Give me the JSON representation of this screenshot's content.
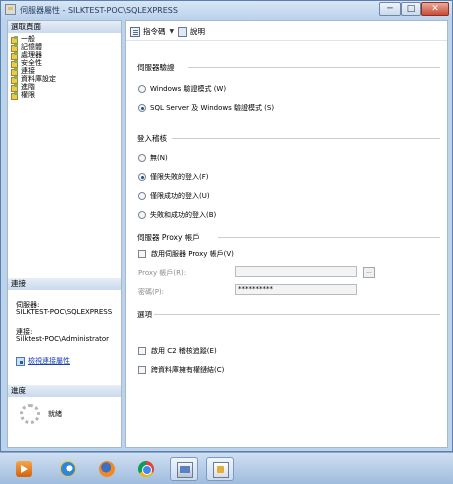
{
  "window": {
    "title": "伺服器屬性 - SILKTEST-POC\\SQLEXPRESS",
    "buttons": {
      "minimize": "─",
      "maximize": "□",
      "close": "✕"
    }
  },
  "left_pane": {
    "select_page_header": "選取頁面",
    "pages": [
      {
        "label": "一般",
        "icon": "page-icon"
      },
      {
        "label": "記憶體",
        "icon": "page-icon"
      },
      {
        "label": "處理器",
        "icon": "page-icon"
      },
      {
        "label": "安全性",
        "icon": "page-icon"
      },
      {
        "label": "連接",
        "icon": "page-icon"
      },
      {
        "label": "資料庫設定",
        "icon": "page-icon"
      },
      {
        "label": "進階",
        "icon": "page-icon"
      },
      {
        "label": "權限",
        "icon": "page-icon"
      }
    ],
    "connection_header": "連接",
    "server_label": "伺服器:",
    "server_value": "SILKTEST-POC\\SQLEXPRESS",
    "connection_label": "連接:",
    "connection_value": "Silktest-POC\\Administrator",
    "view_connection_link": "檢視連接屬性",
    "progress_header": "進度",
    "progress_status": "就緒"
  },
  "toolbar": {
    "script_label": "指令碼",
    "help_label": "說明"
  },
  "server_auth": {
    "title": "伺服器驗證",
    "options": [
      {
        "label": "Windows 驗證模式 (W)",
        "selected": false
      },
      {
        "label": "SQL Server 及 Windows 驗證模式 (S)",
        "selected": true
      }
    ]
  },
  "login_audit": {
    "title": "登入稽核",
    "options": [
      {
        "label": "無(N)",
        "selected": false
      },
      {
        "label": "僅限失敗的登入(F)",
        "selected": true
      },
      {
        "label": "僅限成功的登入(U)",
        "selected": false
      },
      {
        "label": "失敗和成功的登入(B)",
        "selected": false
      }
    ]
  },
  "proxy": {
    "title": "伺服器 Proxy 帳戶",
    "enable_label": "啟用伺服器 Proxy 帳戶(V)",
    "enable_checked": false,
    "account_label": "Proxy 帳戶(R):",
    "account_value": "",
    "password_label": "密碼(P):",
    "password_value": "**********",
    "browse_label": "..."
  },
  "options": {
    "title": "選項",
    "c2_label": "啟用 C2 稽核追蹤(E)",
    "c2_checked": false,
    "cross_db_label": "跨資料庫擁有權鏈結(C)",
    "cross_db_checked": false
  },
  "taskbar": {
    "items": [
      {
        "icon": "media-player-icon",
        "active": false
      },
      {
        "icon": "internet-explorer-icon",
        "active": false
      },
      {
        "icon": "firefox-icon",
        "active": false
      },
      {
        "icon": "chrome-icon",
        "active": false
      },
      {
        "icon": "explorer-icon",
        "active": true
      },
      {
        "icon": "ssms-icon",
        "active": true
      }
    ]
  }
}
